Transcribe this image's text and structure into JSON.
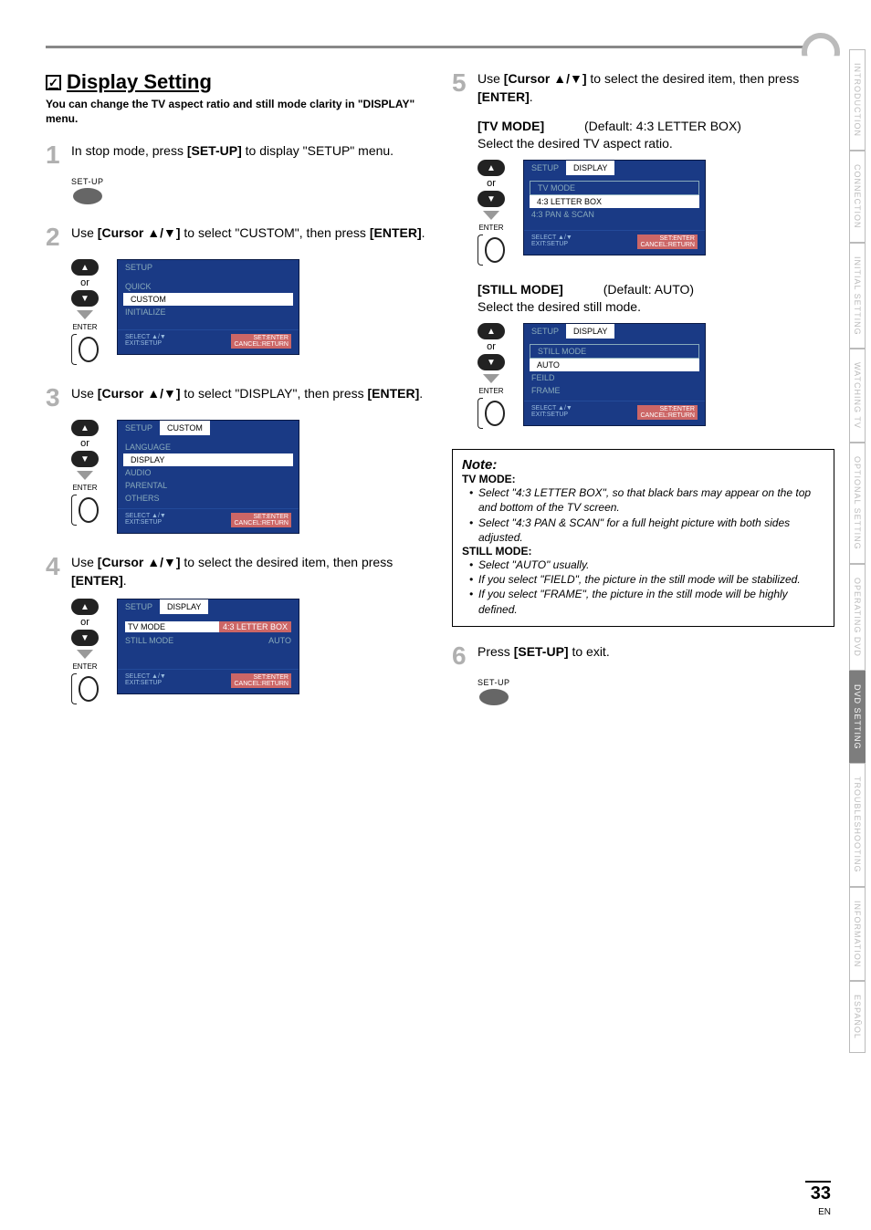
{
  "header": {
    "title": "Display Setting"
  },
  "intro": "You can change the TV aspect ratio and still mode clarity in \"DISPLAY\" menu.",
  "steps": {
    "s1": {
      "num": "1",
      "text_a": "In stop mode, press ",
      "text_b": "[SET-UP]",
      "text_c": " to display \"SETUP\" menu."
    },
    "s2": {
      "num": "2",
      "text_a": "Use ",
      "text_b": "[Cursor ▲/▼]",
      "text_c": " to select \"CUSTOM\", then press ",
      "text_d": "[ENTER]",
      "text_e": "."
    },
    "s3": {
      "num": "3",
      "text_a": "Use ",
      "text_b": "[Cursor ▲/▼]",
      "text_c": " to select \"DISPLAY\", then press ",
      "text_d": "[ENTER]",
      "text_e": "."
    },
    "s4": {
      "num": "4",
      "text_a": "Use ",
      "text_b": "[Cursor ▲/▼]",
      "text_c": " to select the desired item, then press ",
      "text_d": "[ENTER]",
      "text_e": "."
    },
    "s5": {
      "num": "5",
      "text_a": "Use ",
      "text_b": "[Cursor ▲/▼]",
      "text_c": " to select the desired item, then press ",
      "text_d": "[ENTER]",
      "text_e": "."
    },
    "s6": {
      "num": "6",
      "text_a": "Press ",
      "text_b": "[SET-UP]",
      "text_c": " to exit."
    }
  },
  "remote": {
    "setup": "SET-UP",
    "or": "or",
    "enter": "ENTER",
    "up": "▲",
    "down": "▼"
  },
  "osd": {
    "footer_l1": "SELECT ▲/▼",
    "footer_l2": "EXIT:SETUP",
    "footer_r1": "SET:ENTER",
    "footer_r2": "CANCEL:RETURN",
    "screen2": {
      "tab1": "SETUP",
      "items": [
        "QUICK",
        "CUSTOM",
        "INITIALIZE"
      ],
      "sel": "CUSTOM"
    },
    "screen3": {
      "tab1": "SETUP",
      "tab2": "CUSTOM",
      "items": [
        "LANGUAGE",
        "DISPLAY",
        "AUDIO",
        "PARENTAL",
        "OTHERS"
      ],
      "sel": "DISPLAY"
    },
    "screen4": {
      "tab1": "SETUP",
      "tab2": "DISPLAY",
      "rows": [
        {
          "k": "TV MODE",
          "v": "4:3 LETTER BOX",
          "sel": true
        },
        {
          "k": "STILL MODE",
          "v": "AUTO",
          "sel": false
        }
      ]
    },
    "screen5a": {
      "tab1": "SETUP",
      "tab2": "DISPLAY",
      "header": "TV MODE",
      "items": [
        "4:3 LETTER BOX",
        "4:3 PAN & SCAN"
      ],
      "sel": "4:3 LETTER BOX"
    },
    "screen5b": {
      "tab1": "SETUP",
      "tab2": "DISPLAY",
      "header": "STILL MODE",
      "items": [
        "AUTO",
        "FEILD",
        "FRAME"
      ],
      "sel": "AUTO"
    }
  },
  "sub": {
    "tv_mode": {
      "label": "[TV MODE]",
      "default": "(Default: 4:3 LETTER BOX)",
      "desc": "Select the desired TV aspect ratio."
    },
    "still_mode": {
      "label": "[STILL MODE]",
      "default": "(Default: AUTO)",
      "desc": "Select the desired still mode."
    }
  },
  "note": {
    "title": "Note:",
    "tv_head": "TV MODE:",
    "tv_items": [
      "Select \"4:3 LETTER BOX\", so that black bars may appear on the top and bottom of the TV screen.",
      "Select \"4:3 PAN & SCAN\" for a full height picture with both sides adjusted."
    ],
    "still_head": "STILL MODE:",
    "still_items": [
      "Select \"AUTO\" usually.",
      "If you select \"FIELD\", the picture in the still mode will be stabilized.",
      "If you select \"FRAME\", the picture in the still mode will be highly defined."
    ]
  },
  "side_tabs": [
    "INTRODUCTION",
    "CONNECTION",
    "INITIAL SETTING",
    "WATCHING TV",
    "OPTIONAL SETTING",
    "OPERATING DVD",
    "DVD SETTING",
    "TROUBLESHOOTING",
    "INFORMATION",
    "ESPAÑOL"
  ],
  "side_active": "DVD SETTING",
  "page_number": "33",
  "page_lang": "EN"
}
